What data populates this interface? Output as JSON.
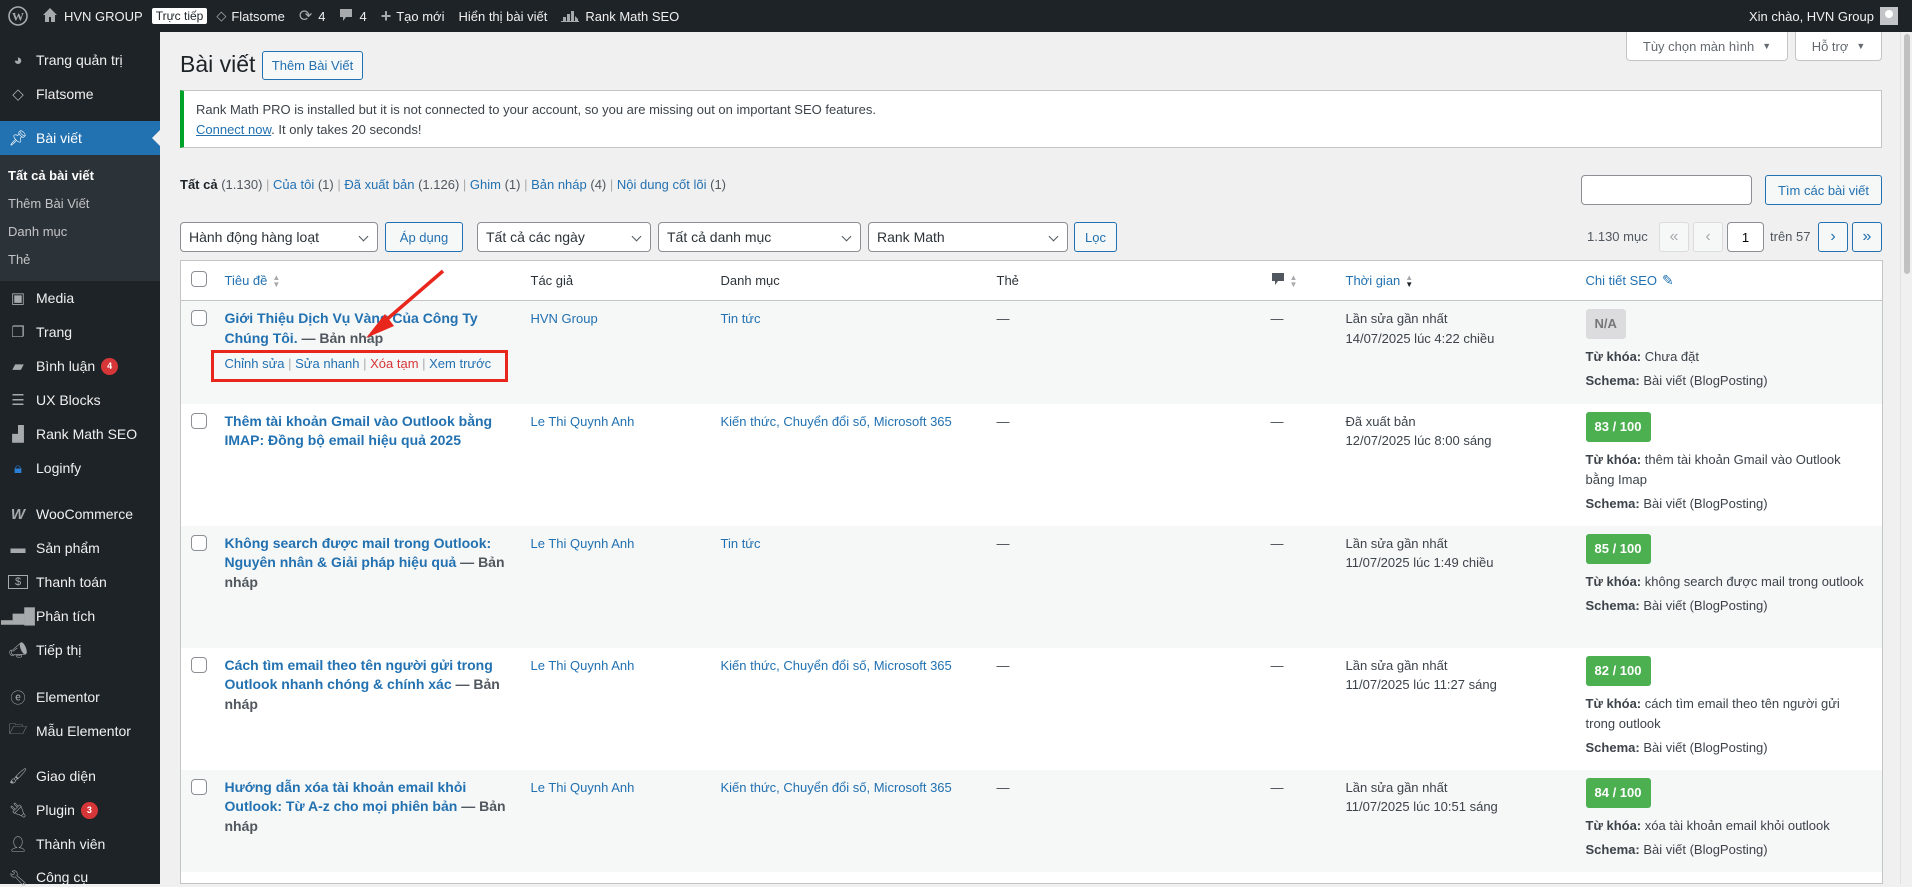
{
  "adminbar": {
    "site_name": "HVN GROUP",
    "live_badge": "Trực tiếp",
    "theme": "Flatsome",
    "updates_count": "4",
    "comments_count": "4",
    "new_label": "Tạo mới",
    "view_posts": "Hiển thị bài viết",
    "rankmath": "Rank Math SEO",
    "greeting": "Xin chào, HVN Group"
  },
  "sidebar": {
    "items": [
      {
        "label": "Trang quản trị"
      },
      {
        "label": "Flatsome"
      },
      {
        "label": "Bài viết"
      },
      {
        "label": "Media"
      },
      {
        "label": "Trang"
      },
      {
        "label": "Bình luận",
        "badge": "4"
      },
      {
        "label": "UX Blocks"
      },
      {
        "label": "Rank Math SEO"
      },
      {
        "label": "Loginfy"
      },
      {
        "label": "WooCommerce"
      },
      {
        "label": "Sản phẩm"
      },
      {
        "label": "Thanh toán"
      },
      {
        "label": "Phân tích"
      },
      {
        "label": "Tiếp thị"
      },
      {
        "label": "Elementor"
      },
      {
        "label": "Mẫu Elementor"
      },
      {
        "label": "Giao diện"
      },
      {
        "label": "Plugin",
        "badge": "3"
      },
      {
        "label": "Thành viên"
      },
      {
        "label": "Công cụ"
      }
    ],
    "submenu": [
      "Tất cả bài viết",
      "Thêm Bài Viết",
      "Danh mục",
      "Thẻ"
    ]
  },
  "header": {
    "title": "Bài viết",
    "add_new": "Thêm Bài Viết",
    "screen_options": "Tùy chọn màn hình",
    "help": "Hỗ trợ"
  },
  "notice": {
    "message": "Rank Math PRO is installed but it is not connected to your account, so you are missing out on important SEO features.",
    "link": "Connect now",
    "suffix": ". It only takes 20 seconds!"
  },
  "views": [
    {
      "label": "Tất cả",
      "count": "(1.130)"
    },
    {
      "label": "Của tôi",
      "count": "(1)"
    },
    {
      "label": "Đã xuất bản",
      "count": "(1.126)"
    },
    {
      "label": "Ghim",
      "count": "(1)"
    },
    {
      "label": "Bản nháp",
      "count": "(4)"
    },
    {
      "label": "Nội dung cốt lõi",
      "count": "(1)"
    }
  ],
  "search": {
    "value": "",
    "button": "Tìm các bài viết"
  },
  "filters": {
    "bulk_action": "Hành động hàng loạt",
    "apply": "Áp dụng",
    "dates": "Tất cả các ngày",
    "categories": "Tất cả danh mục",
    "rankmath": "Rank Math",
    "filter": "Lọc"
  },
  "pagination": {
    "items": "1.130 mục",
    "first": "«",
    "prev": "‹",
    "current": "1",
    "of": "trên 57",
    "next": "›",
    "last": "»"
  },
  "columns": {
    "title": "Tiêu đề",
    "author": "Tác giả",
    "categories": "Danh mục",
    "tags": "Thẻ",
    "date": "Thời gian",
    "seo": "Chi tiết SEO"
  },
  "row_actions": {
    "edit": "Chỉnh sửa",
    "quick_edit": "Sửa nhanh",
    "trash": "Xóa tạm",
    "preview": "Xem trước"
  },
  "seo_labels": {
    "keyword": "Từ khóa:",
    "schema": "Schema:"
  },
  "rows": [
    {
      "title": "Giới Thiệu Dịch Vụ Vàng Của Công Ty Chúng Tôi.",
      "state": " — Bản nháp",
      "author": "HVN Group",
      "categories": "Tin tức",
      "tags": "—",
      "comments": "—",
      "date_status": "Lần sửa gần nhất",
      "date": "14/07/2025 lúc 4:22 chiều",
      "score": "N/A",
      "keyword": "Chưa đặt",
      "schema": "Bài viết (BlogPosting)"
    },
    {
      "title": "Thêm tài khoản Gmail vào Outlook bằng IMAP: Đồng bộ email hiệu quả 2025",
      "state": "",
      "author": "Le Thi Quynh Anh",
      "categories": "Kiến thức, Chuyển đổi số, Microsoft 365",
      "tags": "—",
      "comments": "—",
      "date_status": "Đã xuất bản",
      "date": "12/07/2025 lúc 8:00 sáng",
      "score": "83 / 100",
      "keyword": "thêm tài khoản Gmail vào Outlook bằng Imap",
      "schema": "Bài viết (BlogPosting)"
    },
    {
      "title": "Không search được mail trong Outlook: Nguyên nhân & Giải pháp hiệu quả",
      "state": " — Bản nháp",
      "author": "Le Thi Quynh Anh",
      "categories": "Tin tức",
      "tags": "—",
      "comments": "—",
      "date_status": "Lần sửa gần nhất",
      "date": "11/07/2025 lúc 1:49 chiều",
      "score": "85 / 100",
      "keyword": "không search được mail trong outlook",
      "schema": "Bài viết (BlogPosting)"
    },
    {
      "title": "Cách tìm email theo tên người gửi trong Outlook nhanh chóng & chính xác",
      "state": " — Bản nháp",
      "author": "Le Thi Quynh Anh",
      "categories": "Kiến thức, Chuyển đổi số, Microsoft 365",
      "tags": "—",
      "comments": "—",
      "date_status": "Lần sửa gần nhất",
      "date": "11/07/2025 lúc 11:27 sáng",
      "score": "82 / 100",
      "keyword": "cách tìm email theo tên người gửi trong outlook",
      "schema": "Bài viết (BlogPosting)"
    },
    {
      "title": "Hướng dẫn xóa tài khoản email khỏi Outlook: Từ A-z cho mọi phiên bản",
      "state": " — Bản nháp",
      "author": "Le Thi Quynh Anh",
      "categories": "Kiến thức, Chuyển đổi số, Microsoft 365",
      "tags": "—",
      "comments": "—",
      "date_status": "Lần sửa gần nhất",
      "date": "11/07/2025 lúc 10:51 sáng",
      "score": "84 / 100",
      "keyword": "xóa tài khoản email khỏi outlook",
      "schema": "Bài viết (BlogPosting)"
    }
  ],
  "colors": {
    "accent": "#2271b1",
    "sidebar": "#1d2327",
    "seo_good": "#4caf50",
    "annotation": "#e8261c"
  }
}
